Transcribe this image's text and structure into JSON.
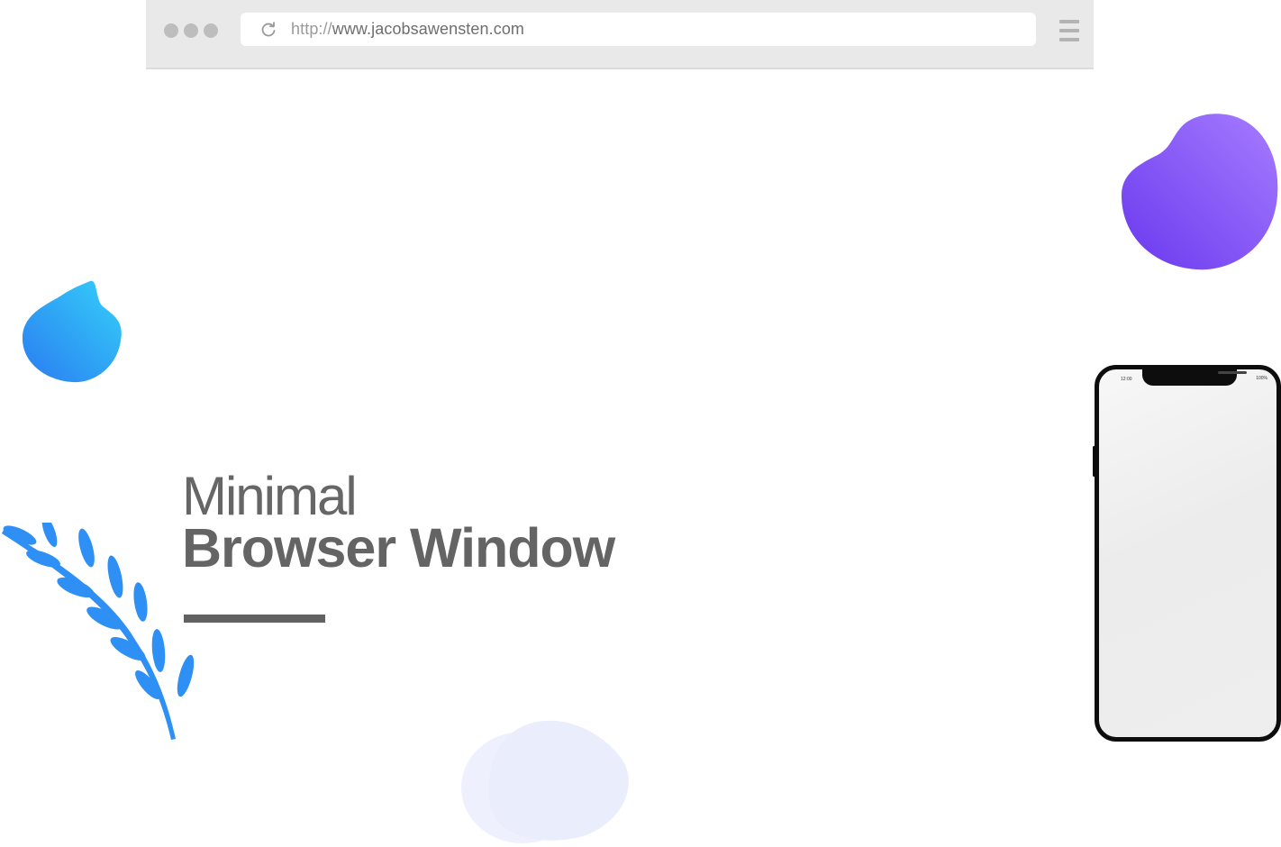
{
  "browser": {
    "url_scheme": "http://",
    "url_host": "www.jacobsawensten.com"
  },
  "hero": {
    "title_light": "Minimal",
    "title_bold": "Browser Window"
  },
  "phone": {
    "status_time": "12:00",
    "status_battery": "100%"
  },
  "icons": {
    "reload": "reload-icon",
    "menu": "hamburger-menu-icon"
  },
  "colors": {
    "chrome_bar": "#e9e9e9",
    "text_gray": "#666666",
    "purple_blob": "#7c4dff",
    "blue_blob": "#2fa0f5",
    "leaf_blue": "#2e8ff5",
    "pale_blob": "#eef1fd"
  }
}
